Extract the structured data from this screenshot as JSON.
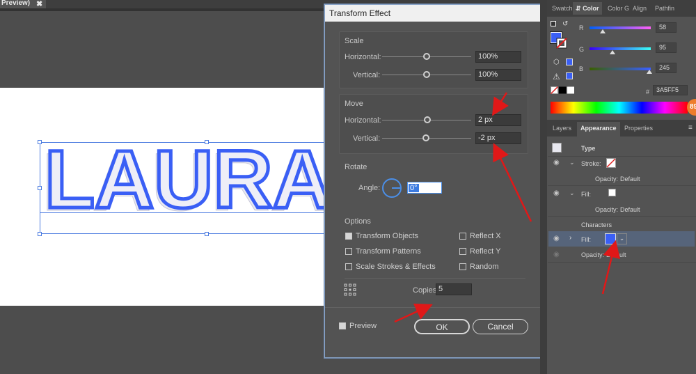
{
  "document": {
    "tab_title": "Preview)",
    "close_glyph": "✖"
  },
  "artwork": {
    "text": "LAURA",
    "fill_color": "#3A5FF5"
  },
  "dialog": {
    "title": "Transform Effect",
    "scale": {
      "section": "Scale",
      "horizontal_label": "Horizontal:",
      "horizontal_value": "100%",
      "vertical_label": "Vertical:",
      "vertical_value": "100%"
    },
    "move": {
      "section": "Move",
      "horizontal_label": "Horizontal:",
      "horizontal_value": "2 px",
      "vertical_label": "Vertical:",
      "vertical_value": "-2 px"
    },
    "rotate": {
      "section": "Rotate",
      "angle_label": "Angle:",
      "angle_value": "0°"
    },
    "options": {
      "section": "Options",
      "transform_objects": "Transform Objects",
      "transform_patterns": "Transform Patterns",
      "scale_strokes": "Scale Strokes & Effects",
      "reflect_x": "Reflect X",
      "reflect_y": "Reflect Y",
      "random": "Random"
    },
    "copies": {
      "label": "Copies",
      "value": "5"
    },
    "preview_label": "Preview",
    "ok_label": "OK",
    "cancel_label": "Cancel"
  },
  "color_panel": {
    "tabs": [
      "Swatch",
      "Color",
      "Color G",
      "Align",
      "Pathfin"
    ],
    "r_label": "R",
    "r_value": "58",
    "g_label": "G",
    "g_value": "95",
    "b_label": "B",
    "b_value": "245",
    "hex_label": "#",
    "hex_value": "3A5FF5",
    "badge": "89",
    "fill_color": "#3A5FF5"
  },
  "appearance_panel": {
    "tabs": [
      "Layers",
      "Appearance",
      "Properties"
    ],
    "type_label": "Type",
    "stroke_label": "Stroke:",
    "opacity1_label": "Opacity:",
    "opacity1_value": "Default",
    "fill_label": "Fill:",
    "opacity2_label": "Opacity:",
    "opacity2_value": "Default",
    "characters_label": "Characters",
    "char_fill_label": "Fill:",
    "opacity3_label": "Opacity:",
    "opacity3_value": "Default"
  }
}
